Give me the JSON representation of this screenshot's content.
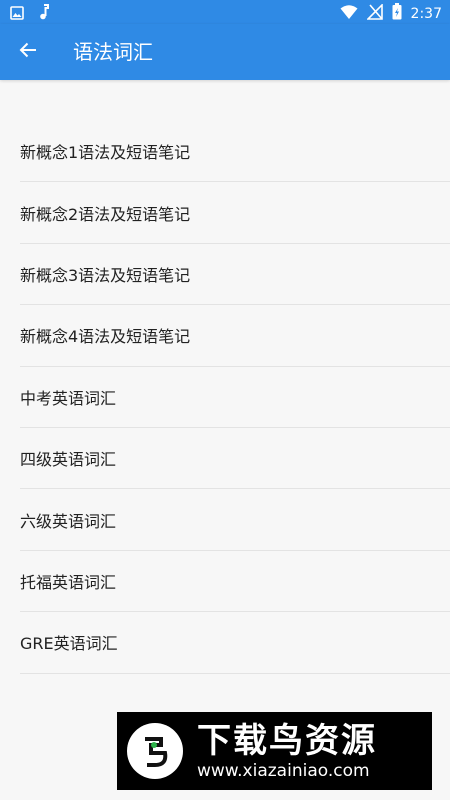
{
  "status_bar": {
    "time": "2:37",
    "icons": [
      "image-icon",
      "music-note-icon",
      "wifi-icon",
      "signal-icon",
      "battery-icon"
    ],
    "background": "#2f8ae5"
  },
  "app_bar": {
    "title": "语法词汇",
    "back_icon": "arrow-back-icon",
    "background": "#2f8ae5"
  },
  "list": {
    "items": [
      {
        "label": "新概念1语法及短语笔记"
      },
      {
        "label": "新概念2语法及短语笔记"
      },
      {
        "label": "新概念3语法及短语笔记"
      },
      {
        "label": "新概念4语法及短语笔记"
      },
      {
        "label": "中考英语词汇"
      },
      {
        "label": "四级英语词汇"
      },
      {
        "label": "六级英语词汇"
      },
      {
        "label": "托福英语词汇"
      },
      {
        "label": "GRE英语词汇"
      }
    ]
  },
  "watermark": {
    "name": "下载鸟资源",
    "url": "www.xiazainiao.com"
  }
}
